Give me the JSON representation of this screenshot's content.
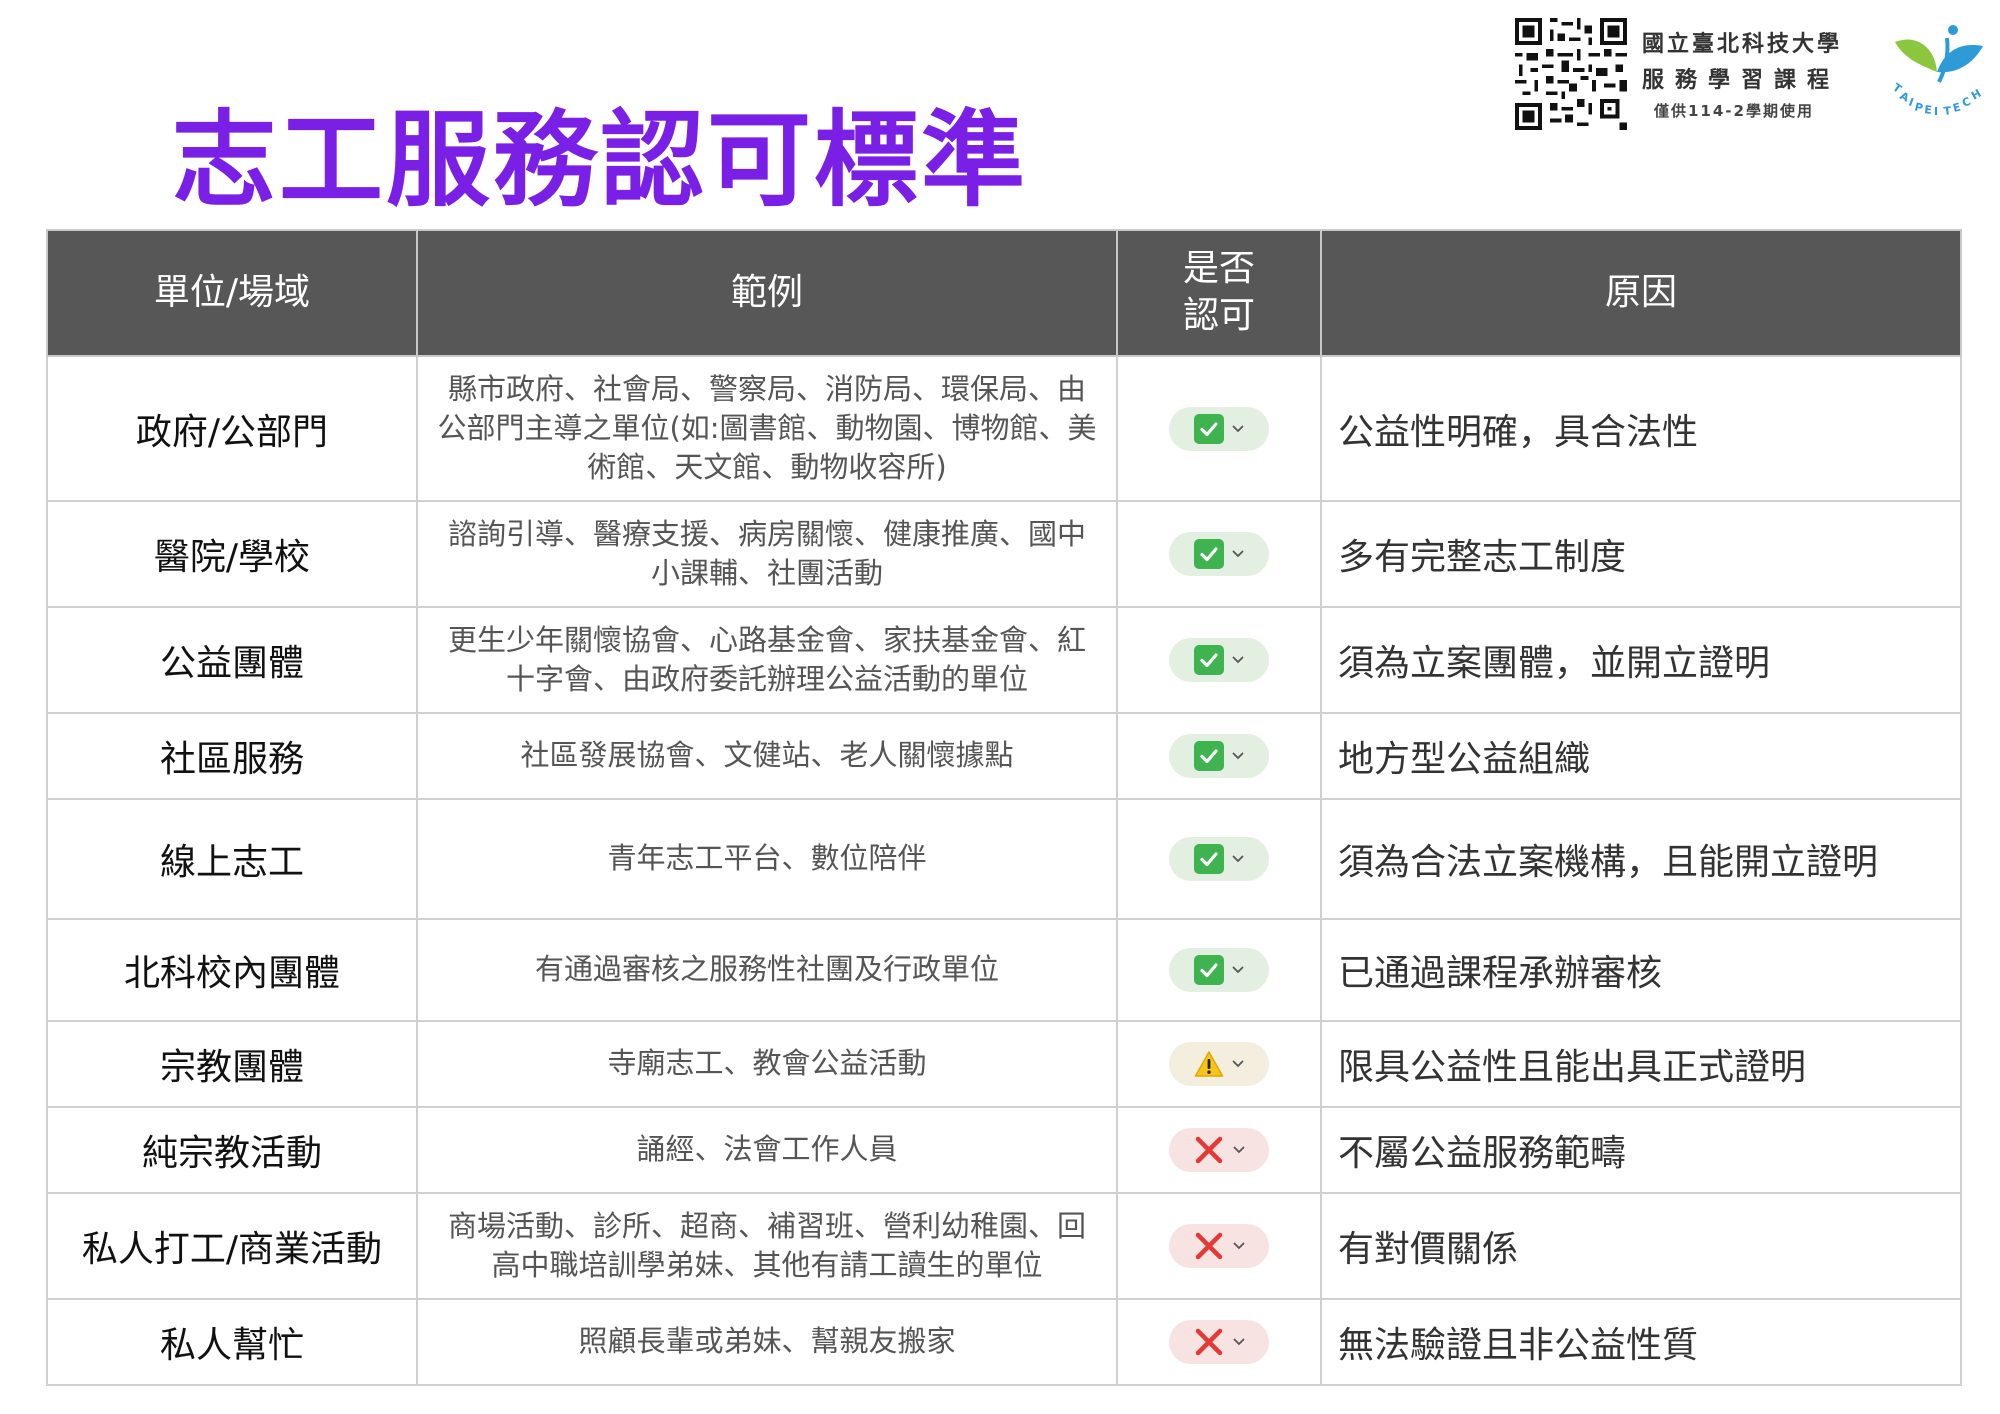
{
  "title": "志工服務認可標準",
  "brand": {
    "line1": "國立臺北科技大學",
    "line2": "服務學習課程",
    "line3": "僅供114-2學期使用",
    "logo_text": "TAIPEI TECH"
  },
  "colors": {
    "title": "#7a1fe6",
    "header_bg": "#575757",
    "approved": "#3fb34f",
    "conditional": "#f5c518",
    "rejected": "#e53935"
  },
  "table": {
    "headers": [
      "單位/場域",
      "範例",
      "是否\n認可",
      "原因"
    ],
    "rows": [
      {
        "unit": "政府/公部門",
        "example": "縣市政府、社會局、警察局、消防局、環保局、由公部門主導之單位(如:圖書館、動物園、博物館、美術館、天文館、動物收容所)",
        "status": "approved",
        "status_icon": "check-icon",
        "reason": "公益性明確，具合法性"
      },
      {
        "unit": "醫院/學校",
        "example": "諮詢引導、醫療支援、病房關懷、健康推廣、國中小課輔、社團活動",
        "status": "approved",
        "status_icon": "check-icon",
        "reason": "多有完整志工制度"
      },
      {
        "unit": "公益團體",
        "example": "更生少年關懷協會、心路基金會、家扶基金會、紅十字會、由政府委託辦理公益活動的單位",
        "status": "approved",
        "status_icon": "check-icon",
        "reason": "須為立案團體，並開立證明"
      },
      {
        "unit": "社區服務",
        "example": "社區發展協會、文健站、老人關懷據點",
        "status": "approved",
        "status_icon": "check-icon",
        "reason": "地方型公益組織"
      },
      {
        "unit": "線上志工",
        "example": "青年志工平台、數位陪伴",
        "status": "approved",
        "status_icon": "check-icon",
        "reason": "須為合法立案機構，且能開立證明"
      },
      {
        "unit": "北科校內團體",
        "example": "有通過審核之服務性社團及行政單位",
        "status": "approved",
        "status_icon": "check-icon",
        "reason": "已通過課程承辦審核"
      },
      {
        "unit": "宗教團體",
        "example": "寺廟志工、教會公益活動",
        "status": "conditional",
        "status_icon": "warning-icon",
        "reason": "限具公益性且能出具正式證明"
      },
      {
        "unit": "純宗教活動",
        "example": "誦經、法會工作人員",
        "status": "rejected",
        "status_icon": "cross-icon",
        "reason": "不屬公益服務範疇"
      },
      {
        "unit": "私人打工/商業活動",
        "example": "商場活動、診所、超商、補習班、營利幼稚園、回高中職培訓學弟妹、其他有請工讀生的單位",
        "status": "rejected",
        "status_icon": "cross-icon",
        "reason": "有對價關係"
      },
      {
        "unit": "私人幫忙",
        "example": "照顧長輩或弟妹、幫親友搬家",
        "status": "rejected",
        "status_icon": "cross-icon",
        "reason": "無法驗證且非公益性質"
      }
    ]
  }
}
